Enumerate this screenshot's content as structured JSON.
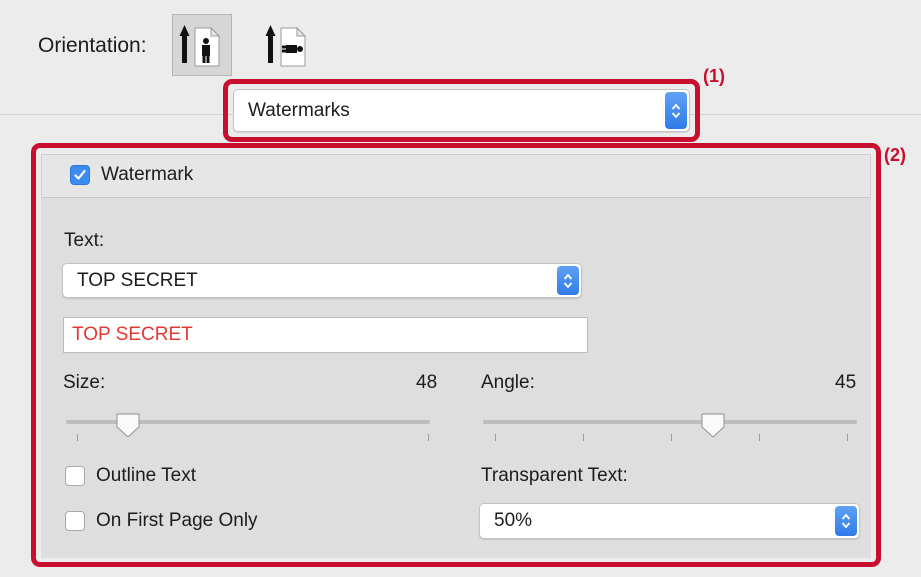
{
  "orientation": {
    "label": "Orientation:",
    "options": [
      {
        "name": "portrait",
        "selected": true
      },
      {
        "name": "landscape",
        "selected": false
      }
    ]
  },
  "panel_selector": {
    "value": "Watermarks"
  },
  "callouts": {
    "one": "(1)",
    "two": "(2)",
    "color": "#c8102e"
  },
  "watermark": {
    "enabled_label": "Watermark",
    "enabled": true,
    "text_label": "Text:",
    "text_preset": "TOP SECRET",
    "text_value": "TOP SECRET",
    "text_value_color": "#e23a33",
    "size": {
      "label": "Size:",
      "value": "48",
      "fraction": 0.16
    },
    "angle": {
      "label": "Angle:",
      "value": "45",
      "fraction": 0.62
    },
    "outline_text": {
      "label": "Outline Text",
      "checked": false
    },
    "first_page_only": {
      "label": "On First Page Only",
      "checked": false
    },
    "transparency": {
      "label": "Transparent Text:",
      "value": "50%"
    }
  },
  "colors": {
    "accent": "#3b8cf0",
    "highlight_frame": "#c8102e"
  }
}
